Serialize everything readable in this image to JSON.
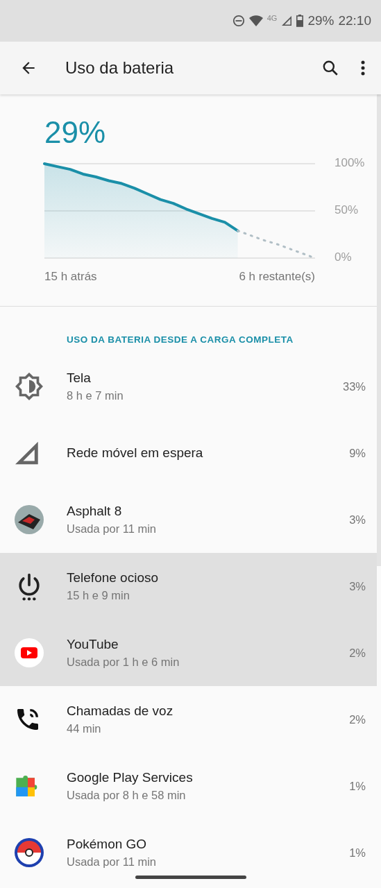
{
  "status_bar": {
    "network": "4G",
    "battery": "29%",
    "time": "22:10"
  },
  "app_bar": {
    "title": "Uso da bateria"
  },
  "battery": {
    "percent": "29%",
    "start_label": "15 h atrás",
    "end_label": "6 h restante(s)",
    "chart_data": {
      "type": "area",
      "categories": [
        null,
        null,
        null,
        null,
        null,
        null,
        null,
        null,
        null,
        null,
        null,
        null,
        null,
        null,
        null,
        null,
        null,
        null,
        null,
        null,
        null,
        null
      ],
      "ylim": [
        0,
        100
      ],
      "yticks": [
        {
          "value": 100,
          "label": "100%"
        },
        {
          "value": 50,
          "label": "50%"
        },
        {
          "value": 0,
          "label": "0%"
        }
      ],
      "series": [
        {
          "color": "#1a8fa8",
          "values": [
            100,
            97,
            94,
            89,
            86,
            82,
            79,
            74,
            68,
            62,
            58,
            52,
            47,
            42,
            38,
            29,
            null,
            null,
            null,
            null,
            null,
            null
          ]
        },
        {
          "color": "#b0bec5",
          "type": "line",
          "line_style": "dotted",
          "values": [
            null,
            null,
            null,
            null,
            null,
            null,
            null,
            null,
            null,
            null,
            null,
            null,
            null,
            null,
            null,
            29,
            24,
            19,
            15,
            10,
            5,
            0
          ]
        }
      ]
    }
  },
  "section_title": "USO DA BATERIA DESDE A CARGA COMPLETA",
  "items": [
    {
      "kind": "brightness",
      "name": "Tela",
      "detail": "8 h e 7 min",
      "percent": "33%",
      "selected": false
    },
    {
      "kind": "signal",
      "name": "Rede móvel em espera",
      "percent": "9%",
      "selected": false
    },
    {
      "kind": "game",
      "name": "Asphalt 8",
      "detail": "Usada por 11 min",
      "percent": "3%",
      "selected": false
    },
    {
      "kind": "power",
      "name": "Telefone ocioso",
      "detail": "15 h e 9 min",
      "percent": "3%",
      "selected": true
    },
    {
      "kind": "video",
      "name": "YouTube",
      "detail": "Usada por 1 h e 6 min",
      "percent": "2%",
      "selected": true
    },
    {
      "kind": "phone",
      "name": "Chamadas de voz",
      "detail": "44 min",
      "percent": "2%",
      "selected": false
    },
    {
      "kind": "puzzle",
      "name": "Google Play Services",
      "detail": "Usada por 8 h e 58 min",
      "percent": "1%",
      "selected": false
    },
    {
      "kind": "ball",
      "name": "Pokémon GO",
      "detail": "Usada por 11 min",
      "percent": "1%",
      "selected": false
    }
  ]
}
